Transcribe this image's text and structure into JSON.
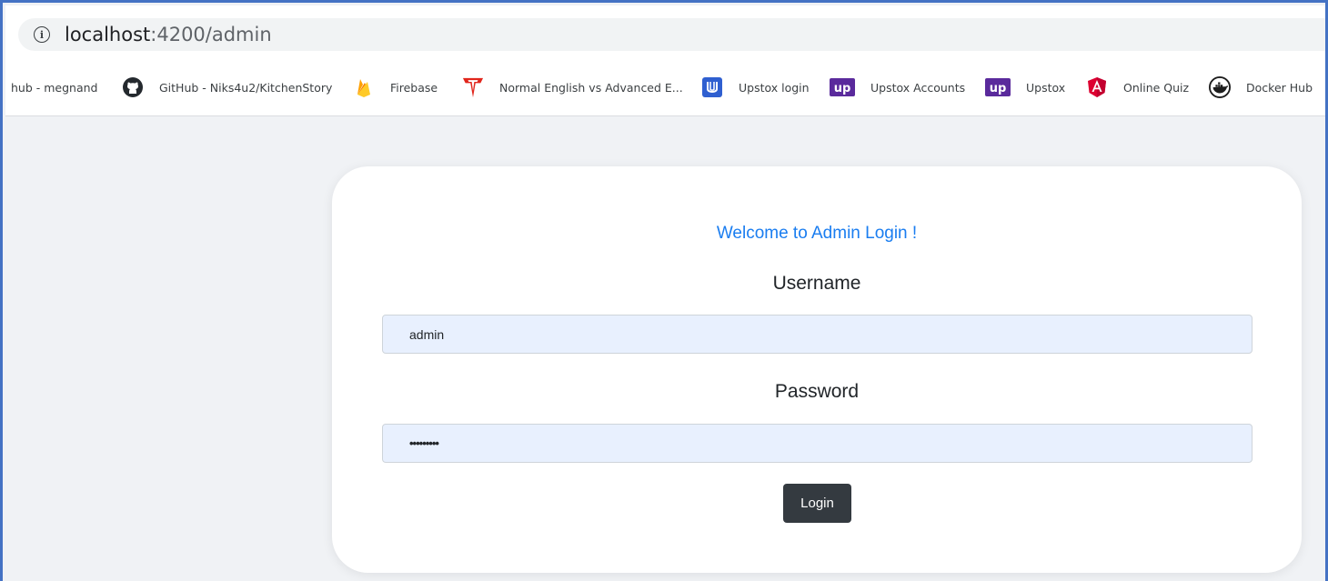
{
  "browser": {
    "url_host": "localhost",
    "url_path": ":4200/admin",
    "bookmarks": [
      {
        "label": "hub - megnand",
        "icon": "none"
      },
      {
        "label": "GitHub - Niks4u2/KitchenStory",
        "icon": "github-icon"
      },
      {
        "label": "Firebase",
        "icon": "firebase-icon"
      },
      {
        "label": "Normal English vs Advanced E...",
        "icon": "red-t-icon"
      },
      {
        "label": "Upstox login",
        "icon": "upstox-u-icon"
      },
      {
        "label": "Upstox Accounts",
        "icon": "upstox-up-icon"
      },
      {
        "label": "Upstox",
        "icon": "upstox-up-icon"
      },
      {
        "label": "Online Quiz",
        "icon": "angular-icon"
      },
      {
        "label": "Docker Hub",
        "icon": "docker-icon"
      }
    ]
  },
  "login": {
    "welcome": "Welcome to Admin Login !",
    "username_label": "Username",
    "username_value": "admin",
    "password_label": "Password",
    "password_value": "•••••••••",
    "button_label": "Login"
  },
  "colors": {
    "accent": "#1a7df0",
    "frame_border": "#4472c4",
    "button_bg": "#343a40",
    "input_bg": "#e8f0fe"
  }
}
